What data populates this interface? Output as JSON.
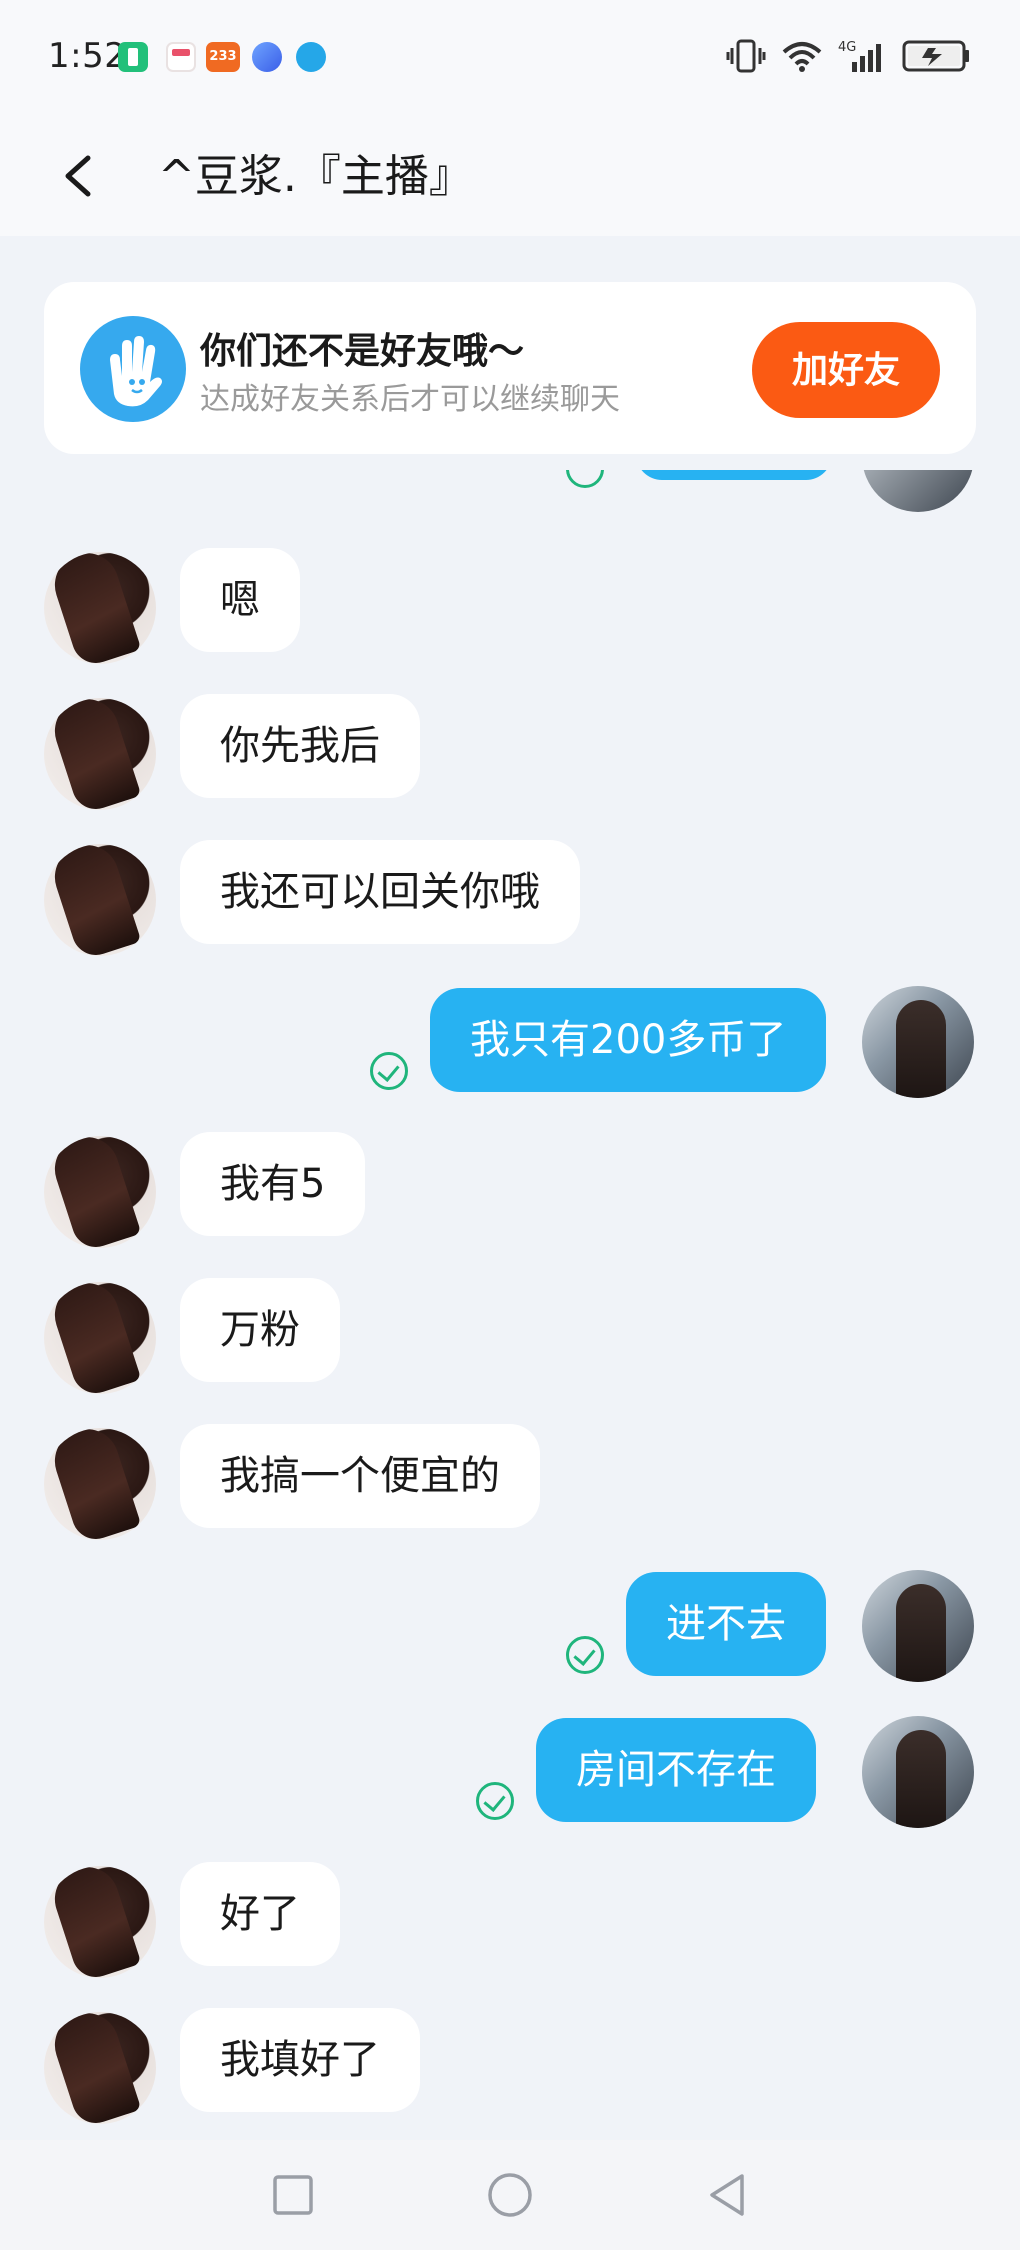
{
  "status_bar": {
    "time": "1:52",
    "notification_badge_233": "233",
    "network": "4G"
  },
  "header": {
    "title": "^豆浆.『主播』"
  },
  "banner": {
    "title": "你们还不是好友哦～",
    "subtitle": "达成好友关系后才可以继续聊天",
    "button_label": "加好友",
    "button_color": "#fb5a13"
  },
  "messages": [
    {
      "side": "left",
      "text": "嗯"
    },
    {
      "side": "left",
      "text": "你先我后"
    },
    {
      "side": "left",
      "text": "我还可以回关你哦"
    },
    {
      "side": "right",
      "text": "我只有200多币了",
      "read": true
    },
    {
      "side": "left",
      "text": "我有5"
    },
    {
      "side": "left",
      "text": "万粉"
    },
    {
      "side": "left",
      "text": "我搞一个便宜的"
    },
    {
      "side": "right",
      "text": "进不去",
      "read": true
    },
    {
      "side": "right",
      "text": "房间不存在",
      "read": true
    },
    {
      "side": "left",
      "text": "好了"
    },
    {
      "side": "left",
      "text": "我填好了"
    }
  ],
  "colors": {
    "outgoing_bubble": "#27b2f2",
    "incoming_bubble": "#ffffff",
    "read_check": "#1fb57c",
    "background": "#f0f3f8"
  },
  "nav_bar": {
    "icons": [
      "recents-square-icon",
      "home-circle-icon",
      "back-triangle-icon"
    ]
  }
}
